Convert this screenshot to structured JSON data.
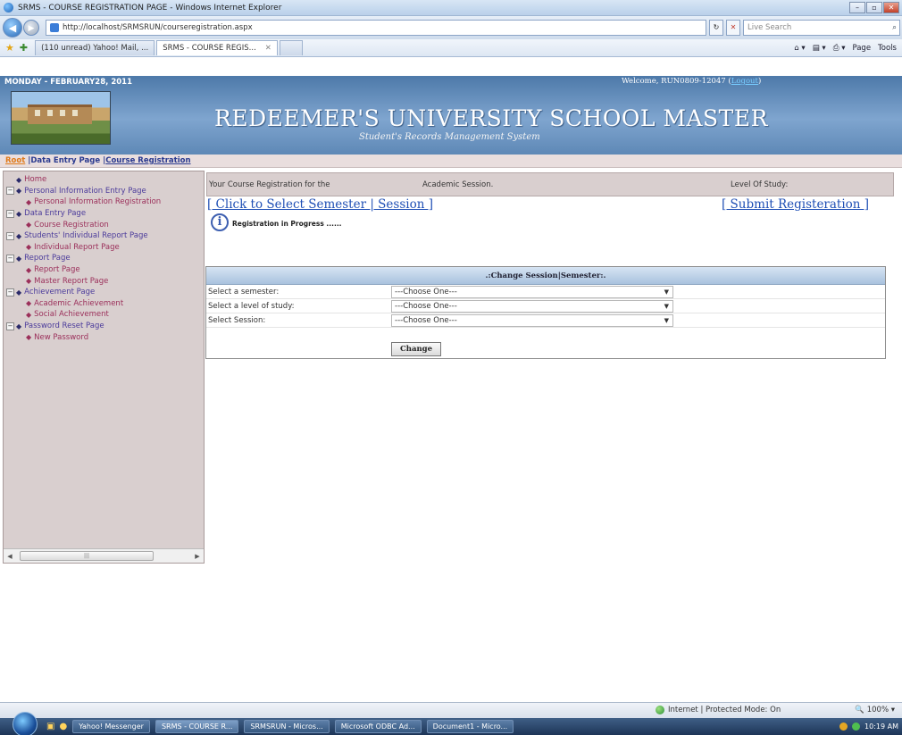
{
  "browser": {
    "title": "SRMS - COURSE REGISTRATION PAGE - Windows Internet Explorer",
    "url": "http://localhost/SRMSRUN/courseregistration.aspx",
    "search_placeholder": "Live Search",
    "fav_tab": "(110 unread) Yahoo! Mail, ...",
    "active_tab": "SRMS - COURSE REGIS...",
    "commands": [
      "Page",
      "Tools"
    ],
    "status_zone": "Internet | Protected Mode: On",
    "zoom": "100%"
  },
  "header": {
    "date": "MONDAY - FEBRUARY28, 2011",
    "welcome": "Welcome, RUN0809-12047 (",
    "logout": "Logout",
    "welcome_close": ")",
    "title": "REDEEMER'S UNIVERSITY SCHOOL MASTER",
    "subtitle": "Student's Records Management System"
  },
  "breadcrumb": {
    "root": "Root",
    "sep1": " |",
    "item1": "Data Entry Page",
    "sep2": " |",
    "item2": "Course Registration"
  },
  "nav": {
    "home": "Home",
    "personal_info_entry": "Personal Information Entry Page",
    "personal_info_reg": "Personal Information Registration",
    "data_entry": "Data Entry Page",
    "course_reg": "Course Registration",
    "students_report": "Students' Individual Report Page",
    "individual_report": "Individual Report Page",
    "report_page": "Report Page",
    "report_sub": "Report Page",
    "master_report": "Master Report Page",
    "achievement": "Achievement Page",
    "academic_ach": "Academic Achievement",
    "social_ach": "Social Achievement",
    "password_reset": "Password Reset Page",
    "new_password": "New Password"
  },
  "main": {
    "reg_for": "Your Course Registration for the",
    "academic_session": "Academic Session.",
    "level_of_study": "Level Of Study:",
    "select_link": "[ Click to Select Semester | Session ]",
    "submit_link": "[ Submit Registeration ]",
    "progress": "Registration in Progress ......"
  },
  "panel": {
    "header": ".:Change Session|Semester:.",
    "semester_label": "Select a semester:",
    "level_label": "Select a level of study:",
    "session_label": "Select Session:",
    "choose": "---Choose One---",
    "change_button": "Change"
  },
  "taskbar": {
    "items": [
      "Yahoo! Messenger",
      "SRMS - COURSE R...",
      "SRMSRUN - Micros...",
      "Microsoft ODBC Ad...",
      "Document1 - Micro..."
    ],
    "time": "10:19 AM"
  }
}
